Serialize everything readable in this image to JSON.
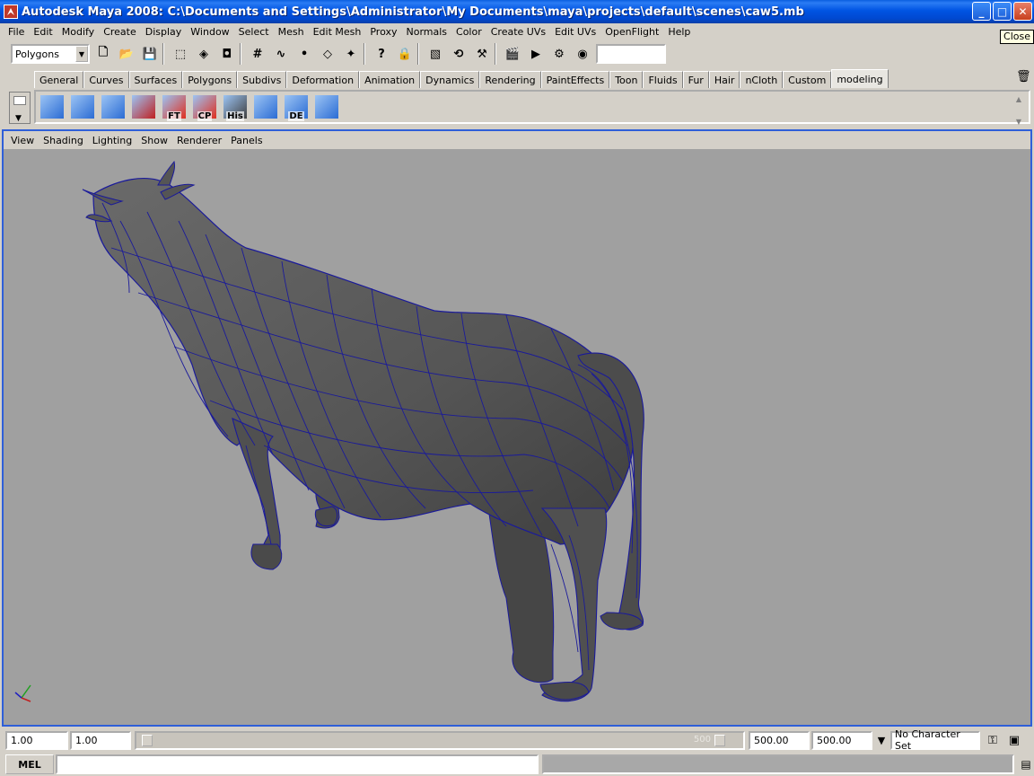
{
  "window": {
    "title": "Autodesk Maya 2008: C:\\Documents and Settings\\Administrator\\My Documents\\maya\\projects\\default\\scenes\\caw5.mb",
    "minimize": "_",
    "maximize": "□",
    "close": "✕",
    "close_tooltip": "Close"
  },
  "menubar": [
    "File",
    "Edit",
    "Modify",
    "Create",
    "Display",
    "Window",
    "Select",
    "Mesh",
    "Edit Mesh",
    "Proxy",
    "Normals",
    "Color",
    "Create UVs",
    "Edit UVs",
    "OpenFlight",
    "Help"
  ],
  "statusline": {
    "mode": "Polygons",
    "icons": [
      "new-scene-icon",
      "open-scene-icon",
      "save-scene-icon",
      "select-hierarchy-icon",
      "select-object-icon",
      "select-component-icon",
      "snap-grid-icon",
      "snap-curve-icon",
      "snap-point-icon",
      "snap-plane-icon",
      "snap-live-icon",
      "help-icon",
      "lock-icon",
      "select-highlight-icon",
      "history-icon",
      "construction-icon",
      "render-icon",
      "ipr-icon",
      "render-settings-icon",
      "hypershade-icon"
    ]
  },
  "shelf_tabs": [
    "General",
    "Curves",
    "Surfaces",
    "Polygons",
    "Subdivs",
    "Deformation",
    "Animation",
    "Dynamics",
    "Rendering",
    "PaintEffects",
    "Toon",
    "Fluids",
    "Fur",
    "Hair",
    "nCloth",
    "Custom",
    "modeling"
  ],
  "active_shelf_tab": "modeling",
  "shelf_buttons": [
    {
      "name": "poly-cube-icon",
      "label": "",
      "color": "#2b6cd4"
    },
    {
      "name": "split-edge-icon",
      "label": "",
      "color": "#2b6cd4"
    },
    {
      "name": "select-tool-icon",
      "label": "",
      "color": "#2b6cd4"
    },
    {
      "name": "curve-tool-icon",
      "label": "",
      "color": "#c02020"
    },
    {
      "name": "freeze-transform-icon",
      "label": "FT",
      "color": "#e03020"
    },
    {
      "name": "center-pivot-icon",
      "label": "CP",
      "color": "#e03020"
    },
    {
      "name": "delete-history-icon",
      "label": "His",
      "color": "#404040"
    },
    {
      "name": "smooth-mesh-icon",
      "label": "",
      "color": "#2b6cd4"
    },
    {
      "name": "delete-edge-icon",
      "label": "DE",
      "color": "#2b6cd4"
    },
    {
      "name": "extrude-icon",
      "label": "",
      "color": "#2b6cd4"
    }
  ],
  "panel_menu": [
    "View",
    "Shading",
    "Lighting",
    "Show",
    "Renderer",
    "Panels"
  ],
  "time": {
    "start": "1.00",
    "current": "1.00",
    "range_max_label": "500",
    "range_end": "500.00",
    "end": "500.00",
    "character_set": "No Character Set"
  },
  "command_line": {
    "language": "MEL",
    "input": ""
  },
  "colors": {
    "viewport_bg": "#a0a0a0",
    "viewport_border": "#2f5fd8",
    "mesh_wire": "#1a1a9a",
    "mesh_fill": "#5a5a5a"
  }
}
